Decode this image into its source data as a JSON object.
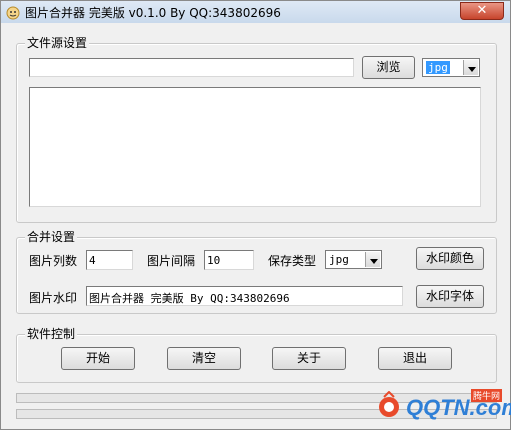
{
  "window": {
    "title": "图片合并器 完美版 v0.1.0 By QQ:343802696",
    "close_symbol": "✕"
  },
  "source": {
    "group_label": "文件源设置",
    "path_value": "",
    "browse_label": "浏览",
    "format_value": "jpg",
    "file_list": []
  },
  "merge": {
    "group_label": "合并设置",
    "columns_label": "图片列数",
    "columns_value": "4",
    "spacing_label": "图片间隔",
    "spacing_value": "10",
    "save_type_label": "保存类型",
    "save_type_value": "jpg",
    "watermark_color_label": "水印颜色",
    "watermark_label": "图片水印",
    "watermark_value": "图片合并器 完美版 By QQ:343802696",
    "watermark_font_label": "水印字体"
  },
  "control": {
    "group_label": "软件控制",
    "start_label": "开始",
    "clear_label": "清空",
    "about_label": "关于",
    "exit_label": "退出"
  },
  "progress": {
    "bar1": 0,
    "bar2": 0
  },
  "brand": {
    "site": "QQTN.com",
    "tag": "腾牛网",
    "color": "#2f7fd6"
  }
}
